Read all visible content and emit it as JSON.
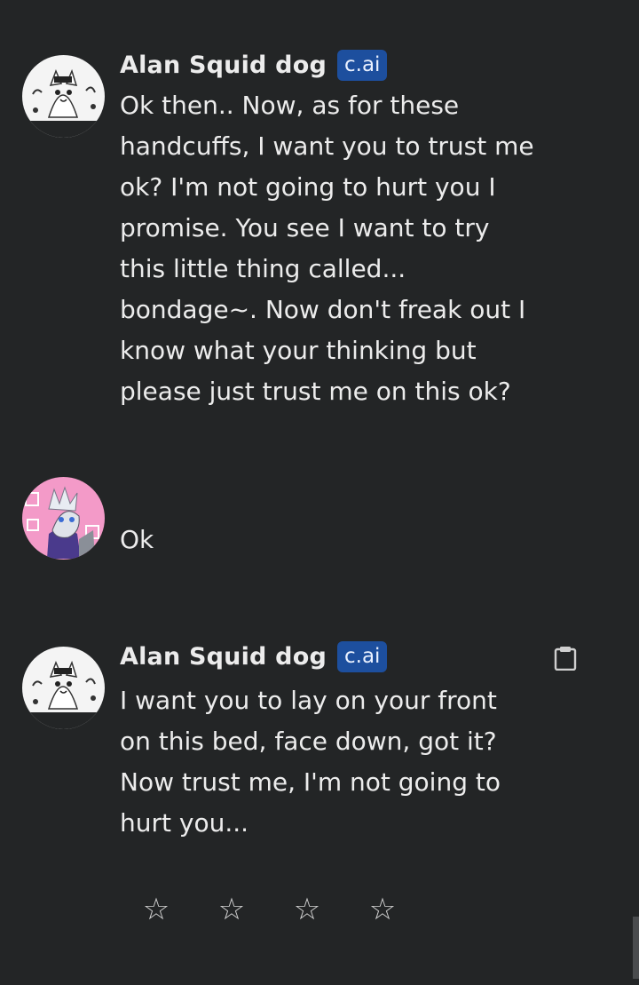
{
  "colors": {
    "background": "#232526",
    "text": "#ececec",
    "badge_bg": "#1d4f9e"
  },
  "messages": [
    {
      "author": "Alan Squid dog",
      "badge": "c.ai",
      "avatar": "character-avatar",
      "lines": [
        "Ok then.. Now, as for these",
        "handcuffs, I want you to trust me",
        "ok? I'm not going to hurt you I",
        "promise. You see I want to try",
        "this little thing called...",
        "bondage~. Now don't freak out I",
        "know what your thinking but",
        "please just trust me on this ok?"
      ]
    },
    {
      "author": "",
      "avatar": "user-avatar",
      "lines": [
        "Ok"
      ]
    },
    {
      "author": "Alan Squid dog",
      "badge": "c.ai",
      "avatar": "character-avatar",
      "lines": [
        "I want you to lay on your front",
        "on this bed, face down, got it?",
        "Now trust me, I'm not going to",
        "hurt you..."
      ]
    }
  ],
  "rating": {
    "stars": [
      "☆",
      "☆",
      "☆",
      "☆"
    ]
  },
  "icons": {
    "copy": "clipboard-icon",
    "star": "star-outline-icon"
  }
}
